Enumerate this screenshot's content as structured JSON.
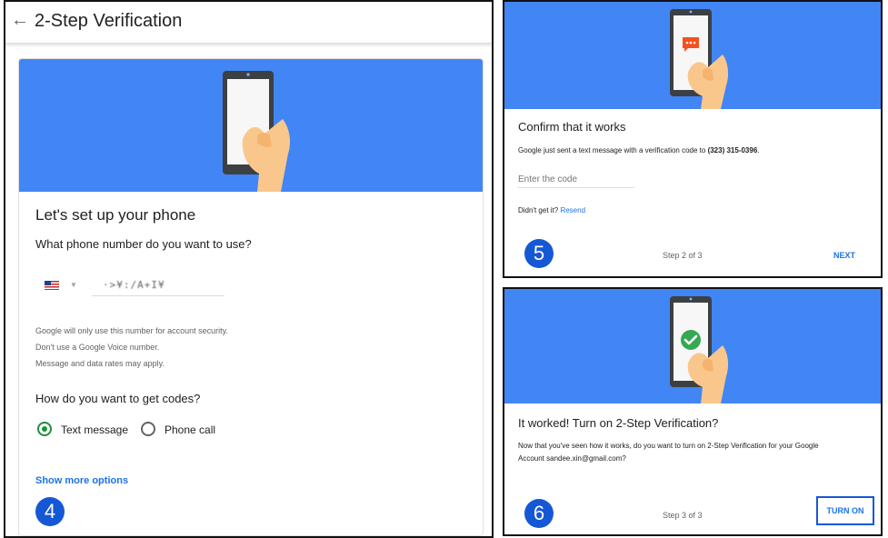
{
  "setup_panel": {
    "back_icon": "arrow-left-icon",
    "title": "2-Step Verification",
    "heading": "Let's set up your phone",
    "question": "What phone number do you want to use?",
    "country_icon": "us-flag-icon",
    "phone_value": "·>¥:/A+I¥",
    "info_lines": [
      "Google will only use this number for account security.",
      "Don't use a Google Voice number.",
      "Message and data rates may apply."
    ],
    "codes_question": "How do you want to get codes?",
    "options": [
      {
        "label": "Text message",
        "selected": true
      },
      {
        "label": "Phone call",
        "selected": false
      }
    ],
    "more_options_link": "Show more options",
    "step_badge": "4"
  },
  "confirm_panel": {
    "heading": "Confirm that it works",
    "message_prefix": "Google just sent a text message with a verification code to ",
    "phone_number": "(323) 315-0396",
    "message_suffix": ".",
    "code_placeholder": "Enter the code",
    "didnt_get": "Didn't get it?",
    "resend_link": "Resend",
    "step_badge": "5",
    "step_label": "Step 2 of 3",
    "next_button": "NEXT",
    "phone_icon": "chat-bubble-icon"
  },
  "turn_on_panel": {
    "heading": "It worked! Turn on 2-Step Verification?",
    "message_line1": "Now that you've seen how it works, do you want to turn on 2-Step Verification for your Google",
    "message_line2": "Account sandee.xin@gmail.com?",
    "step_badge": "6",
    "step_label": "Step 3 of 3",
    "turn_on_button": "TURN ON",
    "phone_icon": "check-circle-icon"
  },
  "colors": {
    "banner_blue": "#4285f4",
    "link_blue": "#1a73e8",
    "badge_blue": "#1558d6",
    "radio_green": "#1e8e3e",
    "check_green": "#34a853",
    "chat_orange": "#f4511e"
  }
}
